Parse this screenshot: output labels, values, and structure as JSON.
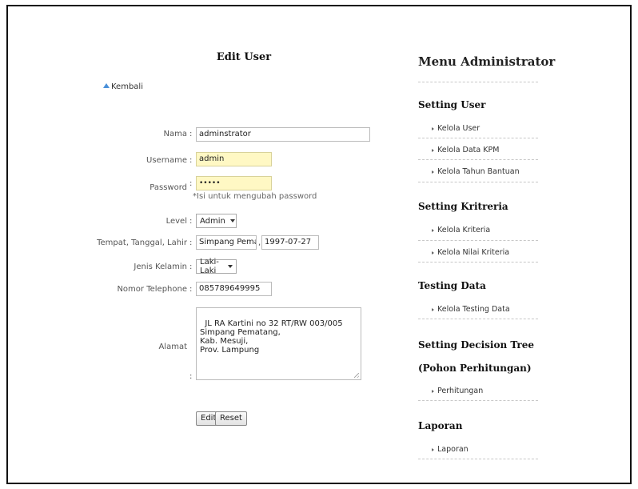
{
  "form": {
    "title": "Edit User",
    "back_label": "Kembali",
    "fields": {
      "nama": {
        "label": "Nama",
        "value": "adminstrator"
      },
      "username": {
        "label": "Username",
        "value": "admin"
      },
      "password": {
        "label": "Password",
        "value": "•••••",
        "hint": "*Isi untuk mengubah password"
      },
      "level": {
        "label": "Level",
        "value": "Admin"
      },
      "ttl": {
        "label": "Tempat, Tanggal, Lahir",
        "place": "Simpang Pematang",
        "date": "1997-07-27"
      },
      "gender": {
        "label": "Jenis Kelamin",
        "value": "Laki-Laki"
      },
      "phone": {
        "label": "Nomor Telephone",
        "value": "085789649995"
      },
      "alamat": {
        "label": "Alamat",
        "value": "JL RA Kartini no 32 RT/RW 003/005\nSimpang Pematang,\nKab. Mesuji,\nProv. Lampung"
      }
    },
    "colon": ":",
    "buttons": {
      "edit": "Edit",
      "reset": "Reset"
    }
  },
  "sidebar": {
    "title": "Menu Administrator",
    "sections": [
      {
        "title": "Setting User",
        "items": [
          "Kelola User",
          "Kelola Data KPM",
          "Kelola Tahun Bantuan"
        ]
      },
      {
        "title": "Setting Kritreria",
        "items": [
          "Kelola Kriteria",
          "Kelola Nilai Kriteria"
        ]
      },
      {
        "title": "Testing Data",
        "items": [
          "Kelola Testing Data"
        ]
      },
      {
        "title_line1": "Setting Decision Tree",
        "title_line2": "(Pohon Perhitungan)",
        "items": [
          "Perhitungan"
        ]
      },
      {
        "title": "Laporan",
        "items": [
          "Laporan"
        ]
      }
    ]
  },
  "colors": {
    "highlight_field": "#fff8c4",
    "back_icon": "#4a90d9"
  }
}
